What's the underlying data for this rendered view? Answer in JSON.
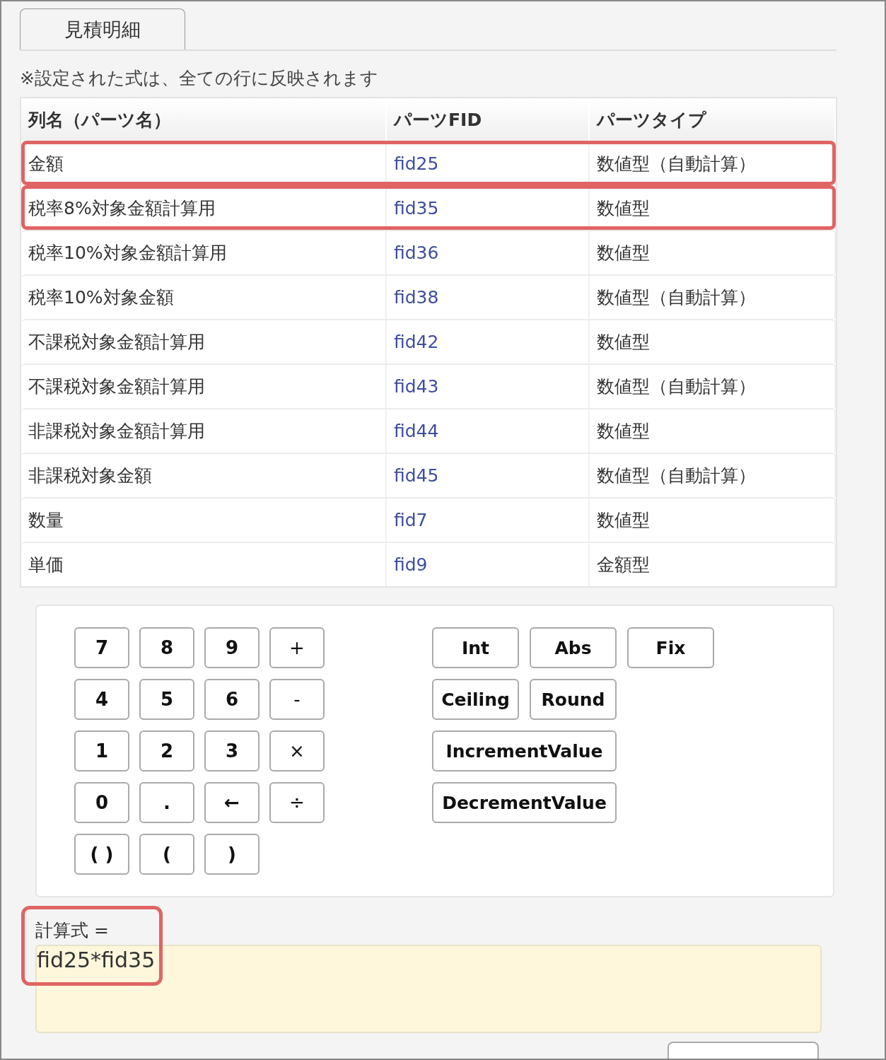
{
  "tab": {
    "label": "見積明細",
    "selected": true
  },
  "note": "※設定された式は、全ての行に反映されます",
  "table": {
    "columns": [
      "列名（パーツ名）",
      "パーツFID",
      "パーツタイプ"
    ],
    "rows": [
      {
        "name": "金額",
        "fid": "fid25",
        "type": "数値型（自動計算）",
        "highlighted": true
      },
      {
        "name": "税率8%対象金額計算用",
        "fid": "fid35",
        "type": "数値型",
        "highlighted": true
      },
      {
        "name": "税率10%対象金額計算用",
        "fid": "fid36",
        "type": "数値型",
        "highlighted": false
      },
      {
        "name": "税率10%対象金額",
        "fid": "fid38",
        "type": "数値型（自動計算）",
        "highlighted": false
      },
      {
        "name": "不課税対象金額計算用",
        "fid": "fid42",
        "type": "数値型",
        "highlighted": false
      },
      {
        "name": "不課税対象金額計算用",
        "fid": "fid43",
        "type": "数値型（自動計算）",
        "highlighted": false
      },
      {
        "name": "非課税対象金額計算用",
        "fid": "fid44",
        "type": "数値型",
        "highlighted": false
      },
      {
        "name": "非課税対象金額",
        "fid": "fid45",
        "type": "数値型（自動計算）",
        "highlighted": false
      },
      {
        "name": "数量",
        "fid": "fid7",
        "type": "数値型",
        "highlighted": false
      },
      {
        "name": "単価",
        "fid": "fid9",
        "type": "金額型",
        "highlighted": false
      }
    ]
  },
  "keypad": [
    "7",
    "8",
    "9",
    "+",
    "4",
    "5",
    "6",
    "-",
    "1",
    "2",
    "3",
    "×",
    "0",
    ".",
    "←",
    "÷",
    "( )",
    "(",
    ")"
  ],
  "functions": [
    {
      "label": "Int",
      "kind": "normal"
    },
    {
      "label": "Abs",
      "kind": "normal"
    },
    {
      "label": "Fix",
      "kind": "normal"
    },
    {
      "label": "Ceiling",
      "kind": "normal"
    },
    {
      "label": "Round",
      "kind": "normal"
    },
    {
      "label": "IncrementValue",
      "kind": "wide"
    },
    {
      "label": "DecrementValue",
      "kind": "wide"
    }
  ],
  "formula": {
    "label": "計算式 =",
    "value": "fid25*fid35",
    "highlighted": true
  }
}
